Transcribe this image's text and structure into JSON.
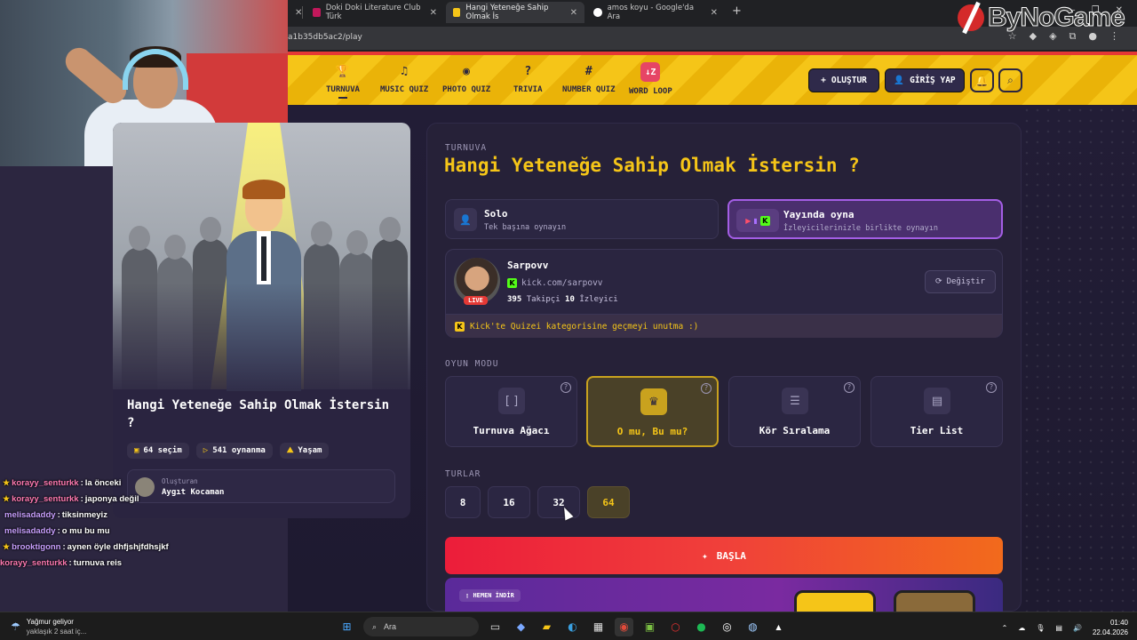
{
  "browser": {
    "tabs": [
      {
        "title": "Doki Doki Literature Club Türk",
        "active": false
      },
      {
        "title": "Hangi Yeteneğe Sahip Olmak İs",
        "active": true
      },
      {
        "title": "amos koyu - Google'da Ara",
        "active": false
      }
    ],
    "newtab": "+",
    "url": "a1b35db5ac2/play",
    "overlay_logo": "ByNoGame"
  },
  "nav": {
    "items": [
      {
        "label": "TURNUVA",
        "icon": "trophy-icon",
        "glyph": "🏆",
        "active": true
      },
      {
        "label": "MUSIC QUIZ",
        "icon": "music-icon",
        "glyph": "♫",
        "active": false
      },
      {
        "label": "PHOTO QUIZ",
        "icon": "camera-icon",
        "glyph": "◉",
        "active": false
      },
      {
        "label": "TRIVIA",
        "icon": "help-icon",
        "glyph": "?",
        "active": false
      },
      {
        "label": "NUMBER QUIZ",
        "icon": "hash-icon",
        "glyph": "#",
        "active": false
      },
      {
        "label": "WORD LOOP",
        "icon": "sort-icon",
        "glyph": "↓Z",
        "active": false
      }
    ],
    "create_label": "OLUŞTUR",
    "login_label": "GİRİŞ YAP"
  },
  "hero": {
    "title": "Hangi Yeteneğe Sahip Olmak İstersin ?",
    "stats": [
      {
        "icon": "choices-icon",
        "glyph": "▣",
        "text": "64 seçim"
      },
      {
        "icon": "play-icon",
        "glyph": "▷",
        "text": "541 oynanma"
      },
      {
        "icon": "category-icon",
        "glyph": "⛰",
        "text": "Yaşam"
      }
    ],
    "creator_label": "Oluşturan",
    "creator_name": "Aygıt Kocaman"
  },
  "chat": [
    {
      "user": "korayy_senturkk",
      "msg": "la önceki",
      "color": "#ff7ab2",
      "badge": true
    },
    {
      "user": "korayy_senturkk",
      "msg": "japonya değil",
      "color": "#ff7ab2",
      "badge": true
    },
    {
      "user": "melisadaddy",
      "msg": "tiksinmeyiz",
      "color": "#c9a0ff",
      "badge": false
    },
    {
      "user": "melisadaddy",
      "msg": "o mu bu mu",
      "color": "#c9a0ff",
      "badge": false
    },
    {
      "user": "brooktigonn",
      "msg": "aynen öyle dhfjshjfdhsjkf",
      "color": "#c9a0ff",
      "badge": true
    },
    {
      "user": "korayy_senturkk",
      "msg": "turnuva reis",
      "color": "#ff7ab2",
      "badge": false
    }
  ],
  "panel": {
    "eyebrow": "TURNUVA",
    "title": "Hangi Yeteneğe Sahip Olmak İstersin ?",
    "solo": {
      "title": "Solo",
      "subtitle": "Tek başına oynayın"
    },
    "stream": {
      "title": "Yayında oyna",
      "subtitle": "İzleyicilerinizle birlikte oynayın"
    },
    "streamer": {
      "name": "Sarpovv",
      "link": "kick.com/sarpovv",
      "followers": "395",
      "followers_label": "Takipçi",
      "viewers": "10",
      "viewers_label": "İzleyici",
      "live": "LIVE",
      "change_label": "Değiştir",
      "notice": "Kick'te Quizei kategorisine geçmeyi unutma :)"
    },
    "mode_label": "OYUN MODU",
    "modes": [
      {
        "label": "Turnuva Ağacı",
        "icon": "bracket-icon",
        "glyph": "[ ]",
        "selected": false
      },
      {
        "label": "O mu, Bu mu?",
        "icon": "crown-icon",
        "glyph": "♛",
        "selected": true
      },
      {
        "label": "Kör Sıralama",
        "icon": "list-icon",
        "glyph": "☰",
        "selected": false
      },
      {
        "label": "Tier List",
        "icon": "tier-icon",
        "glyph": "▤",
        "selected": false
      }
    ],
    "rounds_label": "TURLAR",
    "rounds": [
      "8",
      "16",
      "32",
      "64"
    ],
    "selected_round": "64",
    "start_label": "BAŞLA",
    "promo_badge": "HEMEN İNDİR"
  },
  "taskbar": {
    "weather_title": "Yağmur geliyor",
    "weather_sub": "yaklaşık 2 saat iç...",
    "search_placeholder": "Ara",
    "time": "01:40",
    "date": "22.04.2026"
  }
}
